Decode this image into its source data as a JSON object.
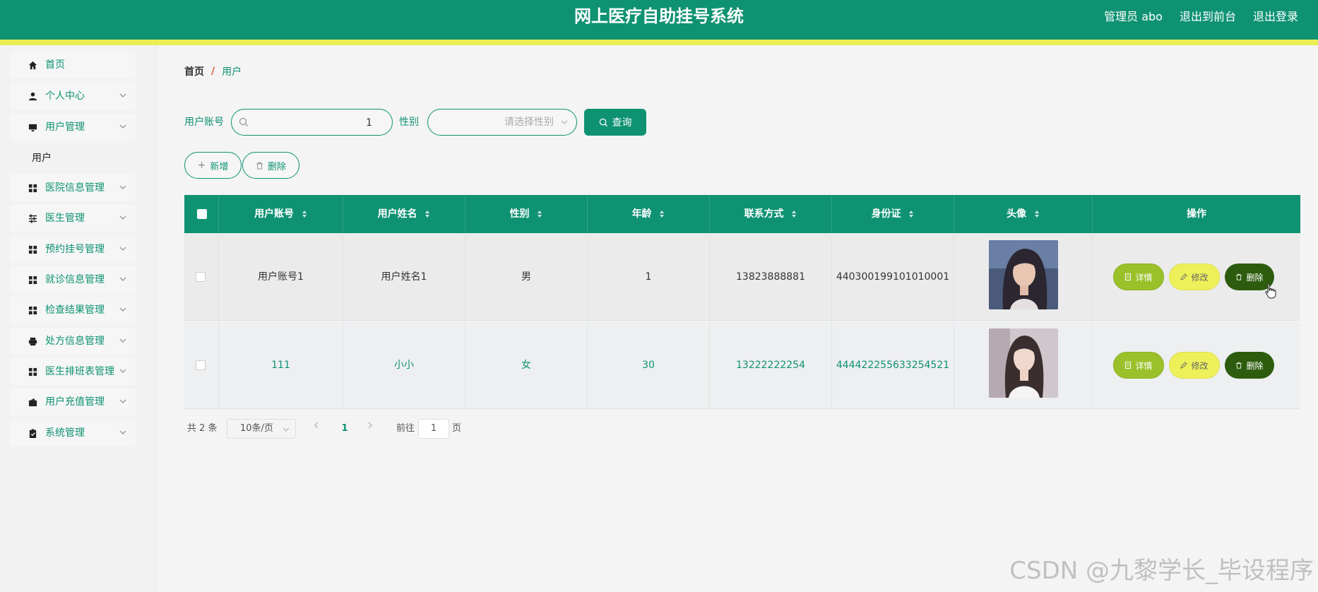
{
  "header": {
    "title": "网上医疗自助挂号系统",
    "admin": "管理员 abo",
    "to_front": "退出到前台",
    "logout": "退出登录",
    "colors": {
      "primary": "#0e9272",
      "stripe": "#e9ee55"
    }
  },
  "sidebar": {
    "items": [
      {
        "label": "首页",
        "icon": "home-icon"
      },
      {
        "label": "个人中心",
        "icon": "user-icon"
      },
      {
        "label": "用户管理",
        "icon": "monitor-icon"
      },
      {
        "label": "用户",
        "icon": ""
      },
      {
        "label": "医院信息管理",
        "icon": "grid-icon"
      },
      {
        "label": "医生管理",
        "icon": "sliders-icon"
      },
      {
        "label": "预约挂号管理",
        "icon": "grid-icon"
      },
      {
        "label": "就诊信息管理",
        "icon": "grid-icon"
      },
      {
        "label": "检查结果管理",
        "icon": "grid-icon"
      },
      {
        "label": "处方信息管理",
        "icon": "printer-icon"
      },
      {
        "label": "医生排班表管理",
        "icon": "grid-icon"
      },
      {
        "label": "用户充值管理",
        "icon": "wallet-icon"
      },
      {
        "label": "系统管理",
        "icon": "clipboard-icon"
      }
    ]
  },
  "breadcrumb": {
    "home": "首页",
    "sep": "/",
    "current": "用户"
  },
  "search": {
    "account_label": "用户账号",
    "account_value": "1",
    "gender_label": "性别",
    "gender_placeholder": "请选择性别",
    "query_label": "查询"
  },
  "actions": {
    "add_label": "新增",
    "delete_label": "删除"
  },
  "table": {
    "headers": [
      "用户账号",
      "用户姓名",
      "性别",
      "年龄",
      "联系方式",
      "身份证",
      "头像",
      "操作"
    ],
    "rows": [
      {
        "account": "用户账号1",
        "name": "用户姓名1",
        "gender": "男",
        "age": "1",
        "phone": "13823888881",
        "id_card": "440300199101010001"
      },
      {
        "account": "111",
        "name": "小小",
        "gender": "女",
        "age": "30",
        "phone": "13222222254",
        "id_card": "444422255633254521"
      }
    ],
    "row_actions": {
      "detail": "详情",
      "edit": "修改",
      "delete": "删除"
    }
  },
  "pagination": {
    "total": "共 2 条",
    "page_size": "10条/页",
    "current_page": "1",
    "goto_label": "前往",
    "goto_value": "1",
    "page_suffix": "页"
  },
  "watermark": "CSDN @九黎学长_毕设程序"
}
